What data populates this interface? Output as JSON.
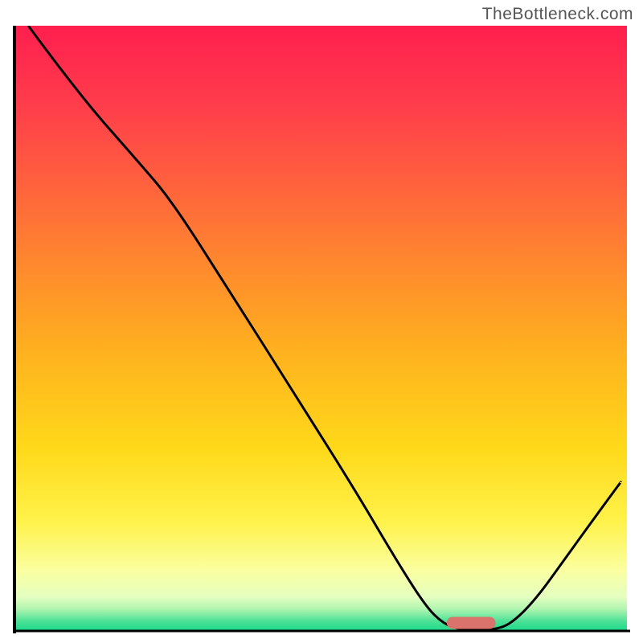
{
  "watermark": "TheBottleneck.com",
  "chart_data": {
    "type": "line",
    "title": "",
    "xlabel": "",
    "ylabel": "",
    "xlim": [
      0,
      100
    ],
    "ylim": [
      0,
      100
    ],
    "gradient": {
      "stops": [
        {
          "offset": 0.0,
          "color": "#ff1f4e"
        },
        {
          "offset": 0.12,
          "color": "#ff3a4c"
        },
        {
          "offset": 0.25,
          "color": "#ff5e3f"
        },
        {
          "offset": 0.4,
          "color": "#ff8a2d"
        },
        {
          "offset": 0.55,
          "color": "#ffb41e"
        },
        {
          "offset": 0.7,
          "color": "#ffd91a"
        },
        {
          "offset": 0.82,
          "color": "#fff24a"
        },
        {
          "offset": 0.9,
          "color": "#fbff9f"
        },
        {
          "offset": 0.945,
          "color": "#e4ffc0"
        },
        {
          "offset": 0.965,
          "color": "#b0f5b0"
        },
        {
          "offset": 0.985,
          "color": "#4de297"
        },
        {
          "offset": 1.0,
          "color": "#1fd98b"
        }
      ]
    },
    "curve_points": [
      {
        "x": 2.0,
        "y": 100.0
      },
      {
        "x": 10.0,
        "y": 89.0
      },
      {
        "x": 20.0,
        "y": 77.5
      },
      {
        "x": 25.5,
        "y": 71.0
      },
      {
        "x": 35.0,
        "y": 56.0
      },
      {
        "x": 45.0,
        "y": 40.0
      },
      {
        "x": 55.0,
        "y": 24.0
      },
      {
        "x": 62.0,
        "y": 12.0
      },
      {
        "x": 67.0,
        "y": 4.0
      },
      {
        "x": 70.0,
        "y": 1.0
      },
      {
        "x": 73.0,
        "y": 0.0
      },
      {
        "x": 78.0,
        "y": 0.0
      },
      {
        "x": 81.0,
        "y": 1.0
      },
      {
        "x": 85.0,
        "y": 5.0
      },
      {
        "x": 90.0,
        "y": 12.0
      },
      {
        "x": 95.0,
        "y": 19.0
      },
      {
        "x": 99.0,
        "y": 24.5
      }
    ],
    "marker": {
      "x": 74.5,
      "y": 1.2,
      "width": 8.0,
      "height": 2.0,
      "rx": 1.0
    }
  }
}
